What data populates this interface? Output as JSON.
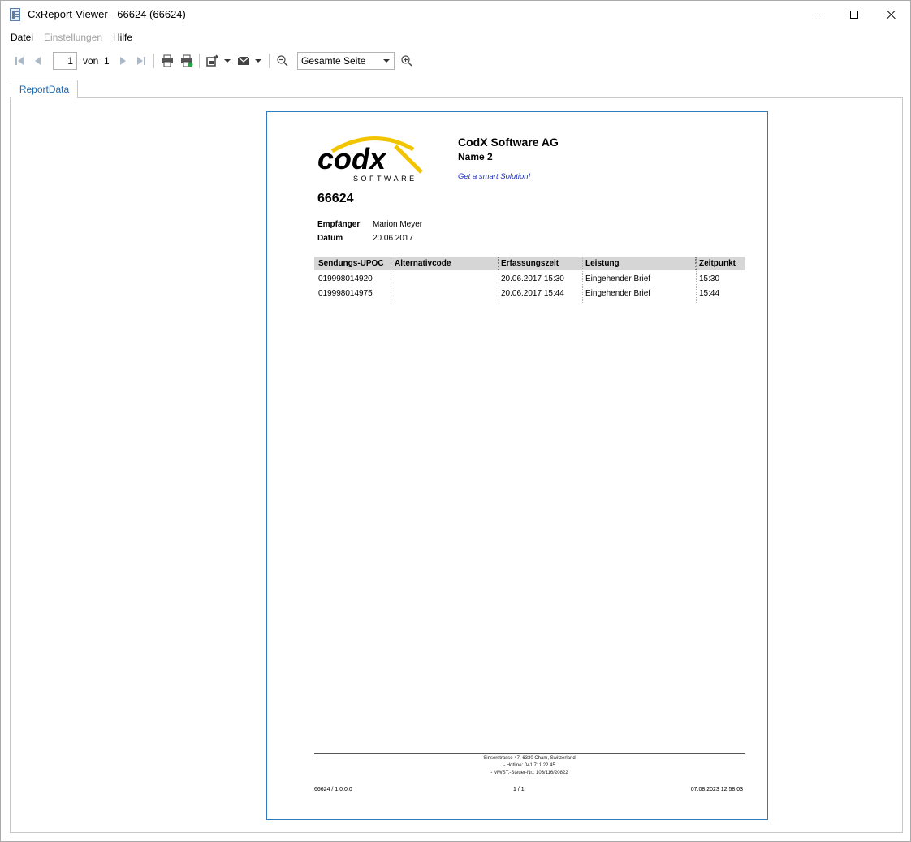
{
  "window": {
    "title": "CxReport-Viewer - 66624 (66624)"
  },
  "menu": {
    "items": [
      {
        "label": "Datei",
        "enabled": true
      },
      {
        "label": "Einstellungen",
        "enabled": false
      },
      {
        "label": "Hilfe",
        "enabled": true
      }
    ]
  },
  "toolbar": {
    "page_current": "1",
    "page_of_label": "von",
    "page_total": "1",
    "zoom_value": "Gesamte Seite",
    "icons": [
      "first-page-icon",
      "prev-page-icon",
      "next-page-icon",
      "last-page-icon",
      "print-icon",
      "print-preview-icon",
      "export-icon",
      "mail-icon",
      "zoom-out-icon",
      "zoom-in-icon"
    ]
  },
  "tabs": [
    {
      "label": "ReportData",
      "active": true
    }
  ],
  "report": {
    "logo_text": "codx",
    "logo_subtext": "SOFTWARE",
    "company": "CodX Software AG",
    "name2": "Name 2",
    "slogan": "Get a smart Solution!",
    "number": "66624",
    "meta": [
      {
        "label": "Empfänger",
        "value": "Marion Meyer"
      },
      {
        "label": "Datum",
        "value": "20.06.2017"
      }
    ],
    "table": {
      "columns": [
        "Sendungs-UPOC",
        "Alternativcode",
        "Erfassungszeit",
        "Leistung",
        "Zeitpunkt"
      ],
      "rows": [
        [
          "019998014920",
          "",
          "20.06.2017 15:30",
          "Eingehender Brief",
          "15:30"
        ],
        [
          "019998014975",
          "",
          "20.06.2017 15:44",
          "Eingehender Brief",
          "15:44"
        ]
      ]
    },
    "footer": {
      "address_lines": [
        "Sinserstrasse 47, 6330 Cham, Switzerland",
        "- Hotline: 041 711 22 45",
        "- MWST.-Steuer-Nr.: 103/116/20822"
      ],
      "left": "66624 / 1.0.0.0",
      "center": "1 / 1",
      "right": "07.08.2023 12:58:03"
    }
  },
  "colors": {
    "accent": "#1a6bb5",
    "page_border": "#2e7bbd",
    "logo_yellow": "#f2c500",
    "slogan": "#1f2fbf",
    "table_header": "#d6d6d6"
  }
}
